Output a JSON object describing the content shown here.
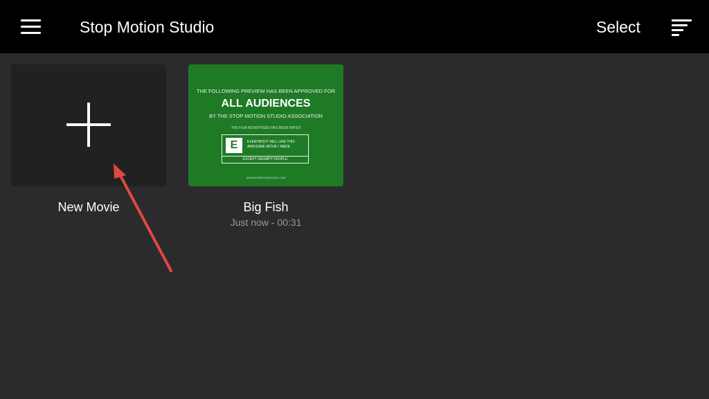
{
  "header": {
    "title": "Stop Motion Studio",
    "menu_icon": "menu-icon",
    "select_label": "Select",
    "sort_icon": "sort-icon"
  },
  "tiles": [
    {
      "kind": "new",
      "label": "New Movie",
      "icon": "plus-icon"
    },
    {
      "kind": "movie",
      "label": "Big Fish",
      "meta": "Just now - 00:31",
      "thumbnail": {
        "line1": "THE FOLLOWING PREVIEW HAS BEEN APPROVED FOR",
        "headline": "ALL AUDIENCES",
        "line2": "BY THE STOP MOTION STUDIO ASSOCIATION",
        "rated_line": "THE FILM ADVERTISED HAS BEEN RATED",
        "rating": "E",
        "rating_desc": "EVERYBODY WILL LIKE THIS AWESOME MOVIE I MADE",
        "except_line": "EXCEPT GRUMPY PEOPLE",
        "footer": "WWW.STOPMOTIONSTUDIO.COM"
      }
    }
  ],
  "colors": {
    "topbar": "#000000",
    "background": "#2b2b2d",
    "new_tile": "#212121",
    "thumbnail_green": "#1f7a26",
    "subtext": "#9a9a9a",
    "annotation_arrow": "#e0493f"
  }
}
